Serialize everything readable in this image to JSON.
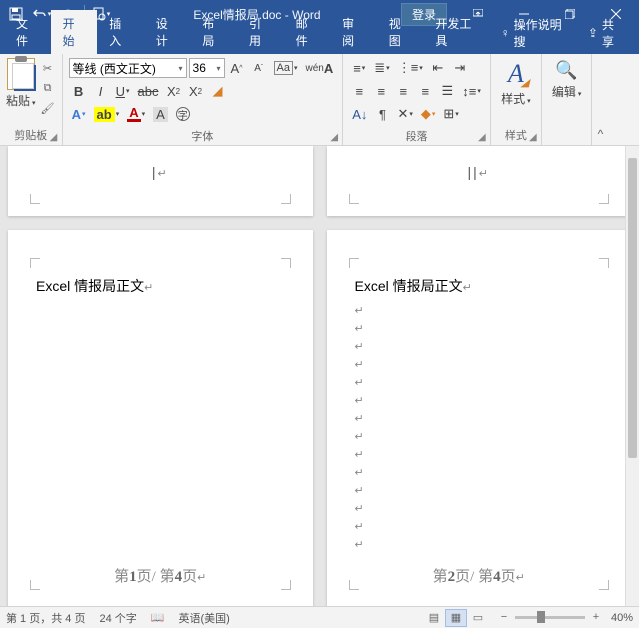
{
  "title_bar": {
    "document_name": "Excel情报局.doc - Word",
    "login": "登录"
  },
  "tabs": {
    "file": "文件",
    "home": "开始",
    "insert": "插入",
    "design": "设计",
    "layout": "布局",
    "references": "引用",
    "mailings": "邮件",
    "review": "审阅",
    "view": "视图",
    "developer": "开发工具",
    "tell_me": "操作说明搜",
    "share": "共享"
  },
  "ribbon": {
    "clipboard": {
      "paste": "粘贴",
      "group": "剪贴板"
    },
    "font": {
      "name": "等线 (西文正文)",
      "size": "36",
      "group": "字体"
    },
    "paragraph": {
      "group": "段落"
    },
    "styles": {
      "btn": "样式",
      "group": "样式"
    },
    "editing": {
      "btn": "编辑"
    }
  },
  "pages": {
    "body_text": "Excel 情报局正文",
    "footer1_a": "第",
    "footer1_b": "1",
    "footer1_c": "页/",
    "footer1_d": "第",
    "footer1_e": "4",
    "footer1_f": "页",
    "footer2_a": "第",
    "footer2_b": "2",
    "footer2_c": "页/",
    "footer2_d": "第",
    "footer2_e": "4",
    "footer2_f": "页",
    "hdr1": "|",
    "hdr2": "||"
  },
  "status": {
    "page": "第 1 页，共 4 页",
    "words": "24 个字",
    "lang": "英语(美国)",
    "zoom": "40%"
  }
}
